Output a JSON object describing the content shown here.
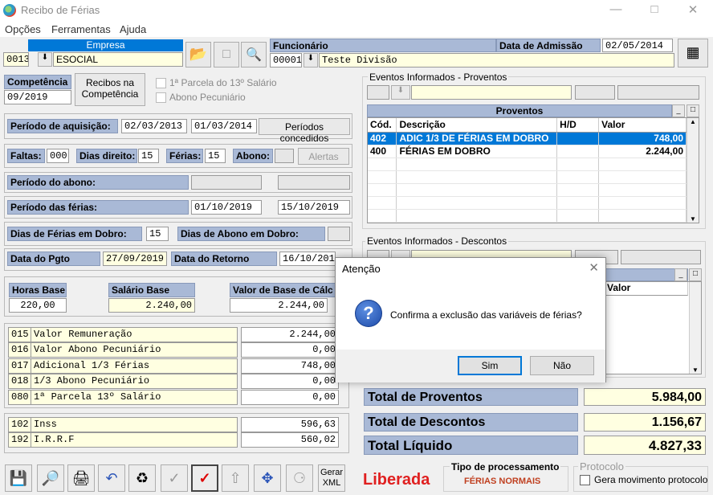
{
  "window": {
    "title": "Recibo de Férias"
  },
  "menu": [
    "Opções",
    "Ferramentas",
    "Ajuda"
  ],
  "empresa": {
    "label": "Empresa",
    "code": "0013",
    "name": "ESOCIAL"
  },
  "funcionario": {
    "label": "Funcionário",
    "code": "00001",
    "name": "Teste Divisão"
  },
  "admissao": {
    "label": "Data de Admissão",
    "value": "02/05/2014"
  },
  "competencia": {
    "label": "Competência",
    "value": "09/2019",
    "recibos_button": "Recibos na Competência"
  },
  "checks": {
    "parcela13": "1ª Parcela do 13º Salário",
    "abono": "Abono Pecuniário"
  },
  "periodo_aquisicao": {
    "label": "Período de aquisição:",
    "from": "02/03/2013",
    "to": "01/03/2014",
    "button": "Períodos concedidos"
  },
  "faltas": {
    "label": "Faltas:",
    "value": "000"
  },
  "dias_direito": {
    "label": "Dias direito:",
    "value": "15"
  },
  "ferias": {
    "label": "Férias:",
    "value": "15"
  },
  "abono": {
    "label": "Abono:",
    "value": ""
  },
  "alertas_button": "Alertas",
  "periodo_abono": {
    "label": "Período do abono:",
    "from": "",
    "to": ""
  },
  "periodo_ferias": {
    "label": "Período das férias:",
    "from": "01/10/2019",
    "to": "15/10/2019"
  },
  "dias_dobro": {
    "label": "Dias de Férias em Dobro:",
    "value": "15"
  },
  "dias_abono_dobro": {
    "label": "Dias de Abono em Dobro:",
    "value": ""
  },
  "data_pgto": {
    "label": "Data do Pgto",
    "value": "27/09/2019"
  },
  "data_retorno": {
    "label": "Data do Retorno",
    "value": "16/10/2019"
  },
  "bases": {
    "horas_label": "Horas Base",
    "horas_value": "220,00",
    "salario_label": "Salário Base",
    "salario_value": "2.240,00",
    "valor_label": "Valor de Base de Cálc",
    "valor_value": "2.244,00"
  },
  "verbas": [
    {
      "code": "015",
      "desc": "Valor Remuneração",
      "value": "2.244,00"
    },
    {
      "code": "016",
      "desc": "Valor Abono Pecuniário",
      "value": "0,00"
    },
    {
      "code": "017",
      "desc": "Adicional 1/3 Férias",
      "value": "748,00"
    },
    {
      "code": "018",
      "desc": "1/3 Abono Pecuniário",
      "value": "0,00"
    },
    {
      "code": "080",
      "desc": "1ª Parcela 13º Salário",
      "value": "0,00"
    }
  ],
  "descontos_verbas": [
    {
      "code": "102",
      "desc": "Inss",
      "value": "596,63"
    },
    {
      "code": "192",
      "desc": "I.R.R.F",
      "value": "560,02"
    }
  ],
  "eventos_proventos": {
    "group_label": "Eventos Informados - Proventos",
    "title": "Proventos",
    "columns": [
      "Cód.",
      "Descrição",
      "H/D",
      "Valor"
    ],
    "rows": [
      {
        "code": "402",
        "desc": "ADIC 1/3 DE FÉRIAS EM DOBRO",
        "hd": "",
        "value": "748,00",
        "selected": true
      },
      {
        "code": "400",
        "desc": "FÉRIAS EM DOBRO",
        "hd": "",
        "value": "2.244,00",
        "selected": false
      }
    ]
  },
  "eventos_descontos": {
    "group_label": "Eventos Informados - Descontos",
    "value_col": "Valor"
  },
  "totais": {
    "proventos_label": "Total de Proventos",
    "proventos_value": "5.984,00",
    "descontos_label": "Total de Descontos",
    "descontos_value": "1.156,67",
    "liquido_label": "Total Líquido",
    "liquido_value": "4.827,33"
  },
  "toolbar": {
    "gerar_xml": "Gerar XML"
  },
  "status": {
    "liberada": "Liberada"
  },
  "tipo_processamento": {
    "label": "Tipo de processamento",
    "value": "FÉRIAS NORMAIS"
  },
  "protocolo": {
    "label": "Protocolo",
    "check_label": "Gera movimento protocolo"
  },
  "dialog": {
    "title": "Atenção",
    "message": "Confirma a exclusão das variáveis de férias?",
    "yes": "Sim",
    "no": "Não"
  }
}
